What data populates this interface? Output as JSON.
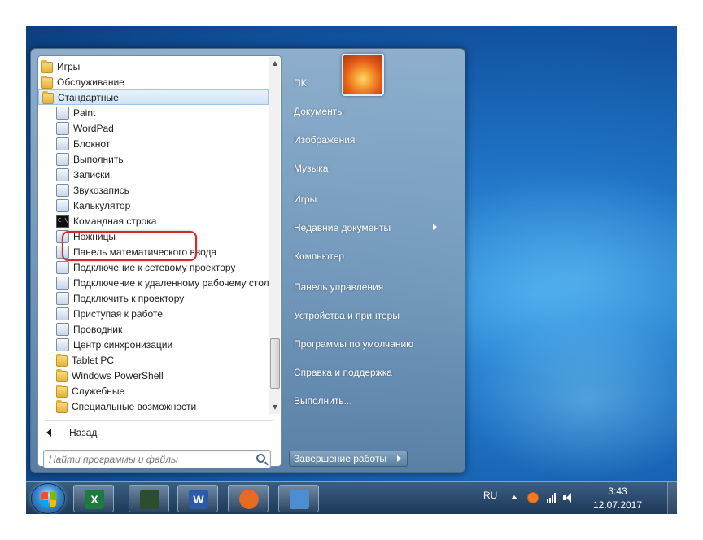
{
  "start_menu": {
    "programs": [
      {
        "label": "Игры",
        "icon": "folder-icon",
        "level": "top"
      },
      {
        "label": "Обслуживание",
        "icon": "folder-icon",
        "level": "top"
      },
      {
        "label": "Стандартные",
        "icon": "folder-icon",
        "level": "top",
        "selected": true
      },
      {
        "label": "Paint",
        "icon": "paint-icon",
        "level": "sub"
      },
      {
        "label": "WordPad",
        "icon": "wordpad-icon",
        "level": "sub"
      },
      {
        "label": "Блокнот",
        "icon": "notepad-icon",
        "level": "sub"
      },
      {
        "label": "Выполнить",
        "icon": "run-icon",
        "level": "sub"
      },
      {
        "label": "Записки",
        "icon": "sticky-notes-icon",
        "level": "sub"
      },
      {
        "label": "Звукозапись",
        "icon": "microphone-icon",
        "level": "sub"
      },
      {
        "label": "Калькулятор",
        "icon": "calculator-icon",
        "level": "sub"
      },
      {
        "label": "Командная строка",
        "icon": "command-prompt-icon",
        "level": "sub"
      },
      {
        "label": "Ножницы",
        "icon": "scissors-icon",
        "level": "sub"
      },
      {
        "label": "Панель математического ввода",
        "icon": "math-input-icon",
        "level": "sub"
      },
      {
        "label": "Подключение к сетевому проектору",
        "icon": "network-projector-icon",
        "level": "sub"
      },
      {
        "label": "Подключение к удаленному рабочему столу",
        "icon": "remote-desktop-icon",
        "level": "sub"
      },
      {
        "label": "Подключить к проектору",
        "icon": "projector-icon",
        "level": "sub"
      },
      {
        "label": "Приступая к работе",
        "icon": "getting-started-icon",
        "level": "sub"
      },
      {
        "label": "Проводник",
        "icon": "explorer-icon",
        "level": "sub"
      },
      {
        "label": "Центр синхронизации",
        "icon": "sync-center-icon",
        "level": "sub"
      },
      {
        "label": "Tablet PC",
        "icon": "folder-icon",
        "level": "sub"
      },
      {
        "label": "Windows PowerShell",
        "icon": "folder-icon",
        "level": "sub"
      },
      {
        "label": "Служебные",
        "icon": "folder-icon",
        "level": "sub"
      },
      {
        "label": "Специальные возможности",
        "icon": "folder-icon",
        "level": "sub"
      }
    ],
    "back_label": "Назад",
    "search_placeholder": "Найти программы и файлы",
    "right_items": [
      {
        "label": "ПК"
      },
      {
        "label": "Документы"
      },
      {
        "label": "Изображения"
      },
      {
        "label": "Музыка"
      },
      {
        "label": "Игры"
      },
      {
        "label": "Недавние документы",
        "submenu": true
      },
      {
        "label": "Компьютер"
      },
      {
        "label": "Панель управления"
      },
      {
        "label": "Устройства и принтеры"
      },
      {
        "label": "Программы по умолчанию"
      },
      {
        "label": "Справка и поддержка"
      },
      {
        "label": "Выполнить..."
      }
    ],
    "shutdown_label": "Завершение работы"
  },
  "taskbar": {
    "pinned": [
      {
        "name": "excel",
        "letter": "X",
        "color": "#1f7a3e"
      },
      {
        "name": "task-manager",
        "letter": "",
        "color": "#2d4d2d"
      },
      {
        "name": "word",
        "letter": "W",
        "color": "#2a5aa8"
      },
      {
        "name": "firefox",
        "letter": "",
        "color": "#e66a1f"
      },
      {
        "name": "control-panel",
        "letter": "",
        "color": "#4c8ed0"
      }
    ],
    "language": "RU",
    "time": "3:43",
    "date": "12.07.2017"
  },
  "colors": {
    "highlight": "#d12a2a",
    "desktop": "#1f72c4"
  }
}
